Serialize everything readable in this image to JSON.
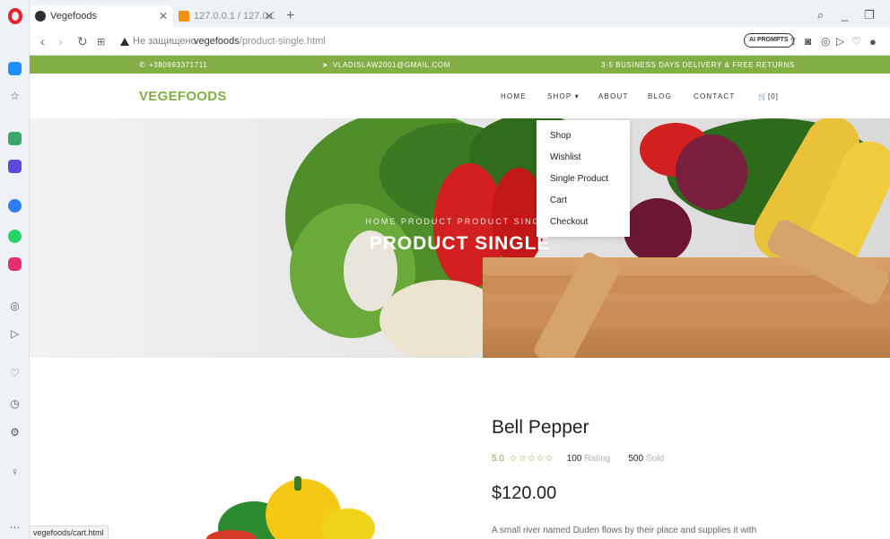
{
  "browser": {
    "tabs": [
      {
        "title": "Vegefoods",
        "active": true
      },
      {
        "title": "127.0.0.1 / 127.0.0.1 / Vege",
        "active": false
      }
    ],
    "new_tab_glyph": "+",
    "security_label": "Не защищено",
    "url_host": "vegefoods",
    "url_path": "/product-single.html",
    "ai_prompts_label": "AI PROMPTS",
    "status_url": "vegefoods/cart.html"
  },
  "topbar": {
    "phone": "+380993371711",
    "email": "VLADISLAW2001@GMAIL.COM",
    "delivery": "3-5 BUSINESS DAYS DELIVERY & FREE RETURNS"
  },
  "navbar": {
    "brand": "VEGEFOODS",
    "links": [
      "HOME",
      "SHOP",
      "ABOUT",
      "BLOG",
      "CONTACT"
    ],
    "cart": "[0]"
  },
  "dropdown": {
    "items": [
      "Shop",
      "Wishlist",
      "Single Product",
      "Cart",
      "Checkout"
    ]
  },
  "hero": {
    "breadcrumb": "HOME  PRODUCT  PRODUCT SINGLE",
    "title": "PRODUCT SINGLE"
  },
  "product": {
    "name": "Bell Pepper",
    "rating": "5.0",
    "stars": "☆☆☆☆☆",
    "rating_count": "100",
    "rating_label": "Rating",
    "sold_count": "500",
    "sold_label": "Sold",
    "price": "$120.00",
    "description": "A small river named Duden flows by their place and supplies it with"
  },
  "colors": {
    "accent": "#82ae46",
    "opera_red": "#e4232c"
  }
}
